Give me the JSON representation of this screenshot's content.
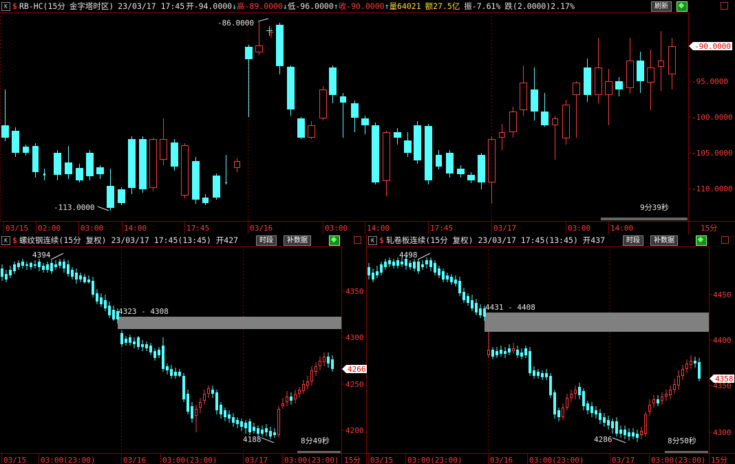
{
  "top": {
    "symbol": "RB-HC(15分",
    "session": "金字塔时区)",
    "datetime": "23/03/17  17:45",
    "open": "开-94.0000",
    "high": "高-89.0000",
    "low": "低-96.0000",
    "close": "收-90.0000",
    "volume": "量64021",
    "amount": "额27.5亿",
    "amplitude": "振-7.61%",
    "change": "跌(2.0000)2.17%",
    "refresh_label": "刷新",
    "price_tag": "-90.0000",
    "y_ticks": [
      "-95.0000",
      "-100.0000",
      "-105.0000",
      "-110.0000"
    ],
    "x_labels": [
      "03/15",
      "02:00",
      "03:00",
      "14:00",
      "17:45",
      "03/16",
      "03:00",
      "14:00",
      "17:45",
      "03/17",
      "03:00",
      "14:00"
    ],
    "period": "15分",
    "hi_label": "-86.0000",
    "lo_label": "-113.0000",
    "countdown": "9分39秒"
  },
  "left": {
    "title": "螺纹钢连续(15分  复权) 23/03/17  17:45(13:45)  开427",
    "btn_time": "时段",
    "btn_fill": "补数据",
    "y_ticks": [
      "4350",
      "4300",
      "4250",
      "4200"
    ],
    "price_tag": "4266",
    "x_labels": [
      "03/15",
      "03:00(23:00)",
      "03/16",
      "03:00(23:00)",
      "03/17",
      "03:00(23:00)"
    ],
    "period": "15分",
    "hi_label": "4394",
    "lo_label": "4188",
    "gap_label": "4323 - 4308",
    "countdown": "8分49秒"
  },
  "right": {
    "title": "轧卷板连续(15分  复权) 23/03/17  17:45(13:45)  开437",
    "btn_time": "时段",
    "btn_fill": "补数据",
    "y_ticks": [
      "4450",
      "4400",
      "4350",
      "4300"
    ],
    "price_tag": "4358",
    "x_labels": [
      "03/15",
      "03:00(23:00)",
      "03/16",
      "03:00(23:00)",
      "03/17",
      "03:00(23:00)"
    ],
    "period": "15分",
    "hi_label": "4498",
    "lo_label": "4286",
    "gap_label": "4431 - 4408",
    "countdown": "8分50秒"
  },
  "colors": {
    "up": "#ff3b3b",
    "down": "#55ffff",
    "grid": "#8b0000",
    "text": "#c0c0c0",
    "tag_bg": "#ffffff"
  }
}
